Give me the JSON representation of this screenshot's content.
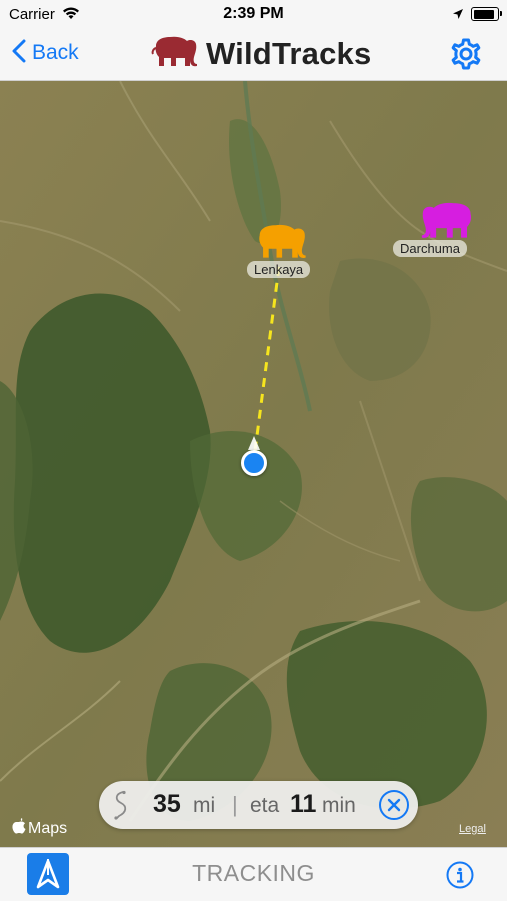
{
  "status_bar": {
    "carrier": "Carrier",
    "time": "2:39 PM"
  },
  "nav": {
    "back_label": "Back",
    "app_title": "WildTracks",
    "brand_color": "#9a2a32",
    "accent_color": "#1479f5"
  },
  "map": {
    "markers": [
      {
        "name": "Lenkaya",
        "color": "#f5a000"
      },
      {
        "name": "Darchuma",
        "color": "#d61ee0"
      }
    ],
    "attribution": "Maps",
    "legal": "Legal"
  },
  "route": {
    "distance_value": "35",
    "distance_unit": "mi",
    "separator": "|",
    "eta_label": "eta",
    "eta_value": "11",
    "eta_unit": "min"
  },
  "tab_bar": {
    "mode_label": "TRACKING"
  },
  "icons": [
    "wifi-icon",
    "location-arrow-icon",
    "battery-icon",
    "chevron-left-icon",
    "elephant-logo-icon",
    "gear-icon",
    "route-icon",
    "close-circle-icon",
    "navigation-arrow-icon",
    "info-icon"
  ]
}
